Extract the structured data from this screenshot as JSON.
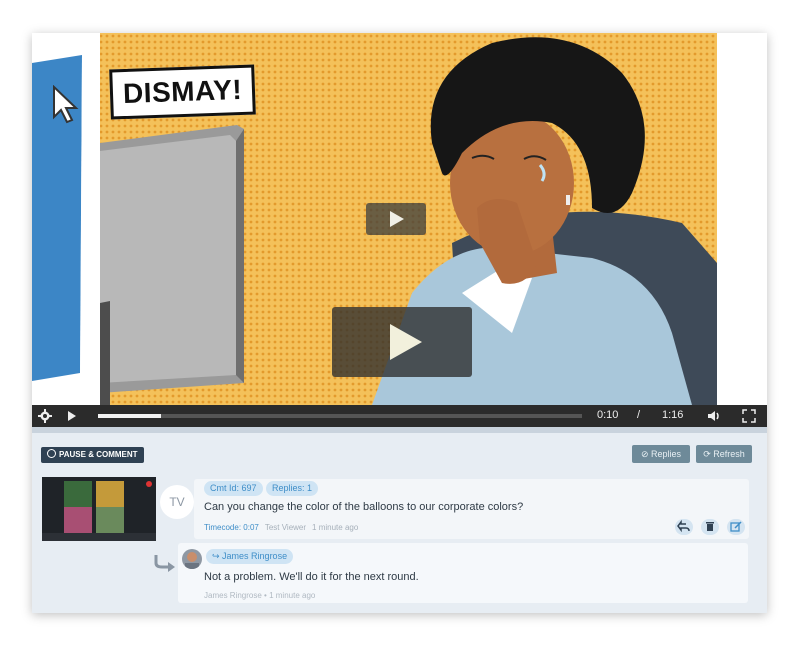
{
  "video": {
    "caption": "DISMAY!",
    "time_current": "0:10",
    "time_separator": "/",
    "time_total": "1:16",
    "progress_fraction": 0.13
  },
  "toolbar": {
    "pause_comment_label": "PAUSE & COMMENT",
    "replies_label": "Replies",
    "refresh_label": "Refresh"
  },
  "comment": {
    "avatar_initials": "TV",
    "cmt_id": "Cmt Id: 697",
    "replies_count": "Replies: 1",
    "text": "Can you change the color of the balloons to our corporate colors?",
    "timecode": "Timecode: 0:07",
    "author": "Test Viewer",
    "time_ago": "1 minute ago"
  },
  "reply": {
    "author_tag": "James Ringrose",
    "text": "Not a problem. We'll do it for the next round.",
    "author": "James Ringrose",
    "separator": "•",
    "time_ago": "1 minute ago"
  },
  "colors": {
    "accent": "#3f8ec8",
    "controls_bg": "#2b2b2b",
    "button_dark": "#2f4153",
    "button_muted": "#6e8a99",
    "panel_bg": "#e7edf3"
  }
}
